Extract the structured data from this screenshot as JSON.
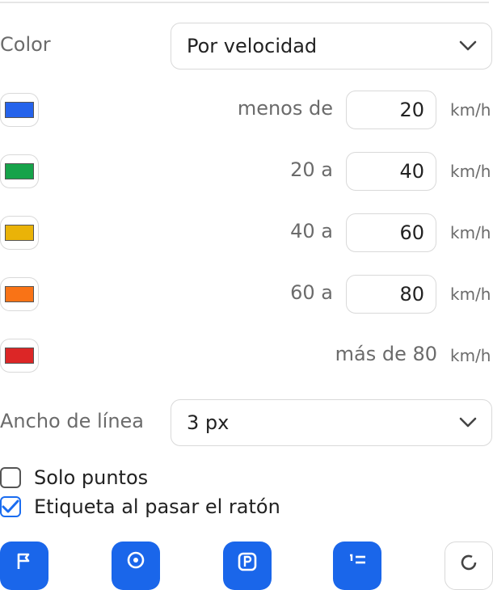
{
  "color_setting": {
    "label": "Color",
    "selected": "Por velocidad"
  },
  "speed_ranges": [
    {
      "range_label": "menos de",
      "value": "20",
      "unit": "km/h",
      "swatch_color": "#2563eb"
    },
    {
      "range_label": "20 a",
      "value": "40",
      "unit": "km/h",
      "swatch_color": "#16a34a"
    },
    {
      "range_label": "40 a",
      "value": "60",
      "unit": "km/h",
      "swatch_color": "#eab308"
    },
    {
      "range_label": "60 a",
      "value": "80",
      "unit": "km/h",
      "swatch_color": "#f97316"
    },
    {
      "range_label": "más de 80",
      "unit": "km/h",
      "swatch_color": "#dc2626"
    }
  ],
  "line_width": {
    "label": "Ancho de línea",
    "selected": "3 px"
  },
  "options": {
    "only_points": {
      "label": "Solo puntos",
      "checked": false
    },
    "hover_label": {
      "label": "Etiqueta al pasar el ratón",
      "checked": true
    }
  },
  "toolbar": {
    "icons": [
      "flag-icon",
      "location-pin-icon",
      "parking-icon",
      "numbered-list-icon",
      "refresh-icon"
    ],
    "accent_color": "#1a66ea"
  }
}
